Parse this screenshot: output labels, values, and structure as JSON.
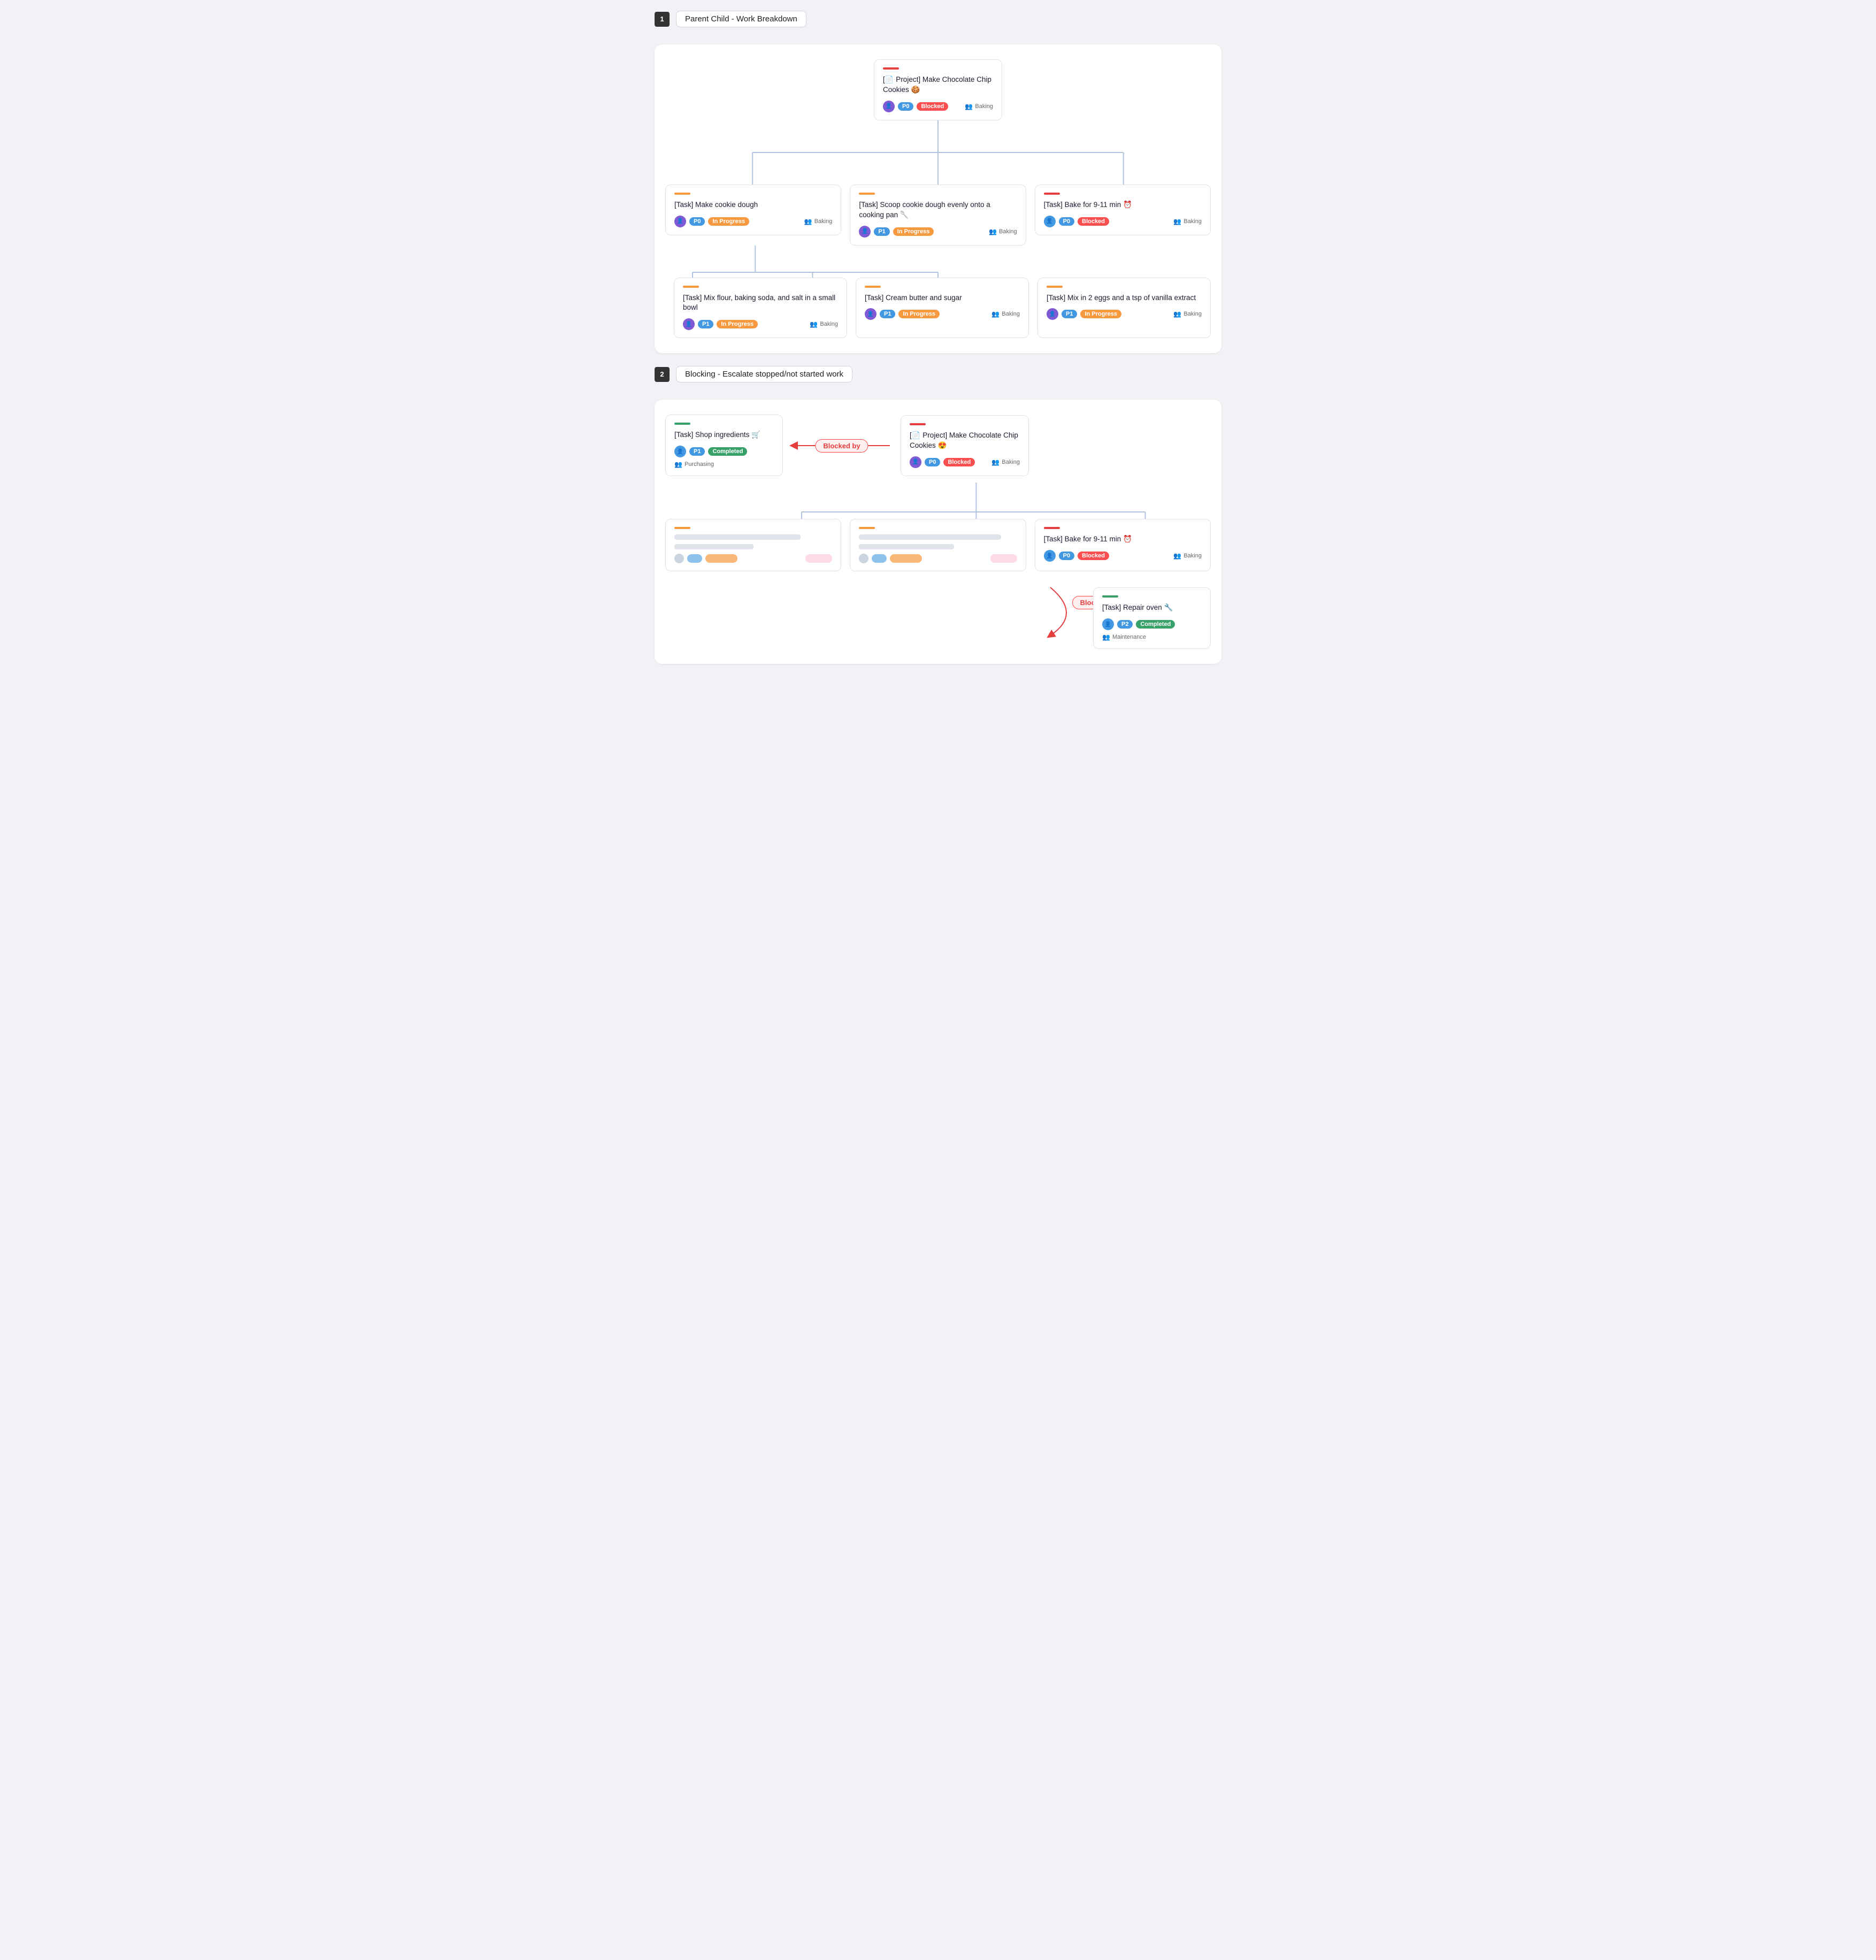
{
  "section1": {
    "number": "1",
    "title": "Parent Child - Work Breakdown",
    "root": {
      "accent": "red",
      "title": "[📄 Project] Make Chocolate Chip Cookies 🍪",
      "priority": "P0",
      "status": "Blocked",
      "team": "Baking"
    },
    "level1": [
      {
        "accent": "orange",
        "title": "[Task] Make cookie dough",
        "priority": "P0",
        "status": "In Progress",
        "team": "Baking"
      },
      {
        "accent": "orange",
        "title": "[Task] Scoop cookie dough evenly onto a cooking pan 🥄",
        "priority": "P1",
        "status": "In Progress",
        "team": "Baking"
      },
      {
        "accent": "red",
        "title": "[Task] Bake for 9-11 min ⏰",
        "priority": "P0",
        "status": "Blocked",
        "team": "Baking"
      }
    ],
    "level2": [
      {
        "accent": "orange",
        "title": "[Task] Mix flour, baking soda, and salt in a small bowl",
        "priority": "P1",
        "status": "In Progress",
        "team": "Baking"
      },
      {
        "accent": "orange",
        "title": "[Task] Cream butter and sugar",
        "priority": "P1",
        "status": "In Progress",
        "team": "Baking"
      },
      {
        "accent": "orange",
        "title": "[Task] Mix in 2 eggs and a tsp of vanilla extract",
        "priority": "P1",
        "status": "In Progress",
        "team": "Baking"
      }
    ]
  },
  "section2": {
    "number": "2",
    "title": "Blocking - Escalate stopped/not started work",
    "shopTask": {
      "accent": "green",
      "title": "[Task] Shop ingredients 🛒",
      "priority": "P1",
      "status": "Completed",
      "team": "Purchasing"
    },
    "blockedBy1": "Blocked by",
    "projectNode": {
      "accent": "red",
      "title": "[📄 Project] Make Chocolate Chip Cookies 😍",
      "priority": "P0",
      "status": "Blocked",
      "team": "Baking"
    },
    "bakeTask": {
      "accent": "red",
      "title": "[Task] Bake for 9-11 min ⏰",
      "priority": "P0",
      "status": "Blocked",
      "team": "Baking"
    },
    "blockedBy2": "Blocked by",
    "repairTask": {
      "accent": "green",
      "title": "[Task] Repair oven 🔧",
      "priority": "P2",
      "status": "Completed",
      "team": "Maintenance"
    }
  }
}
